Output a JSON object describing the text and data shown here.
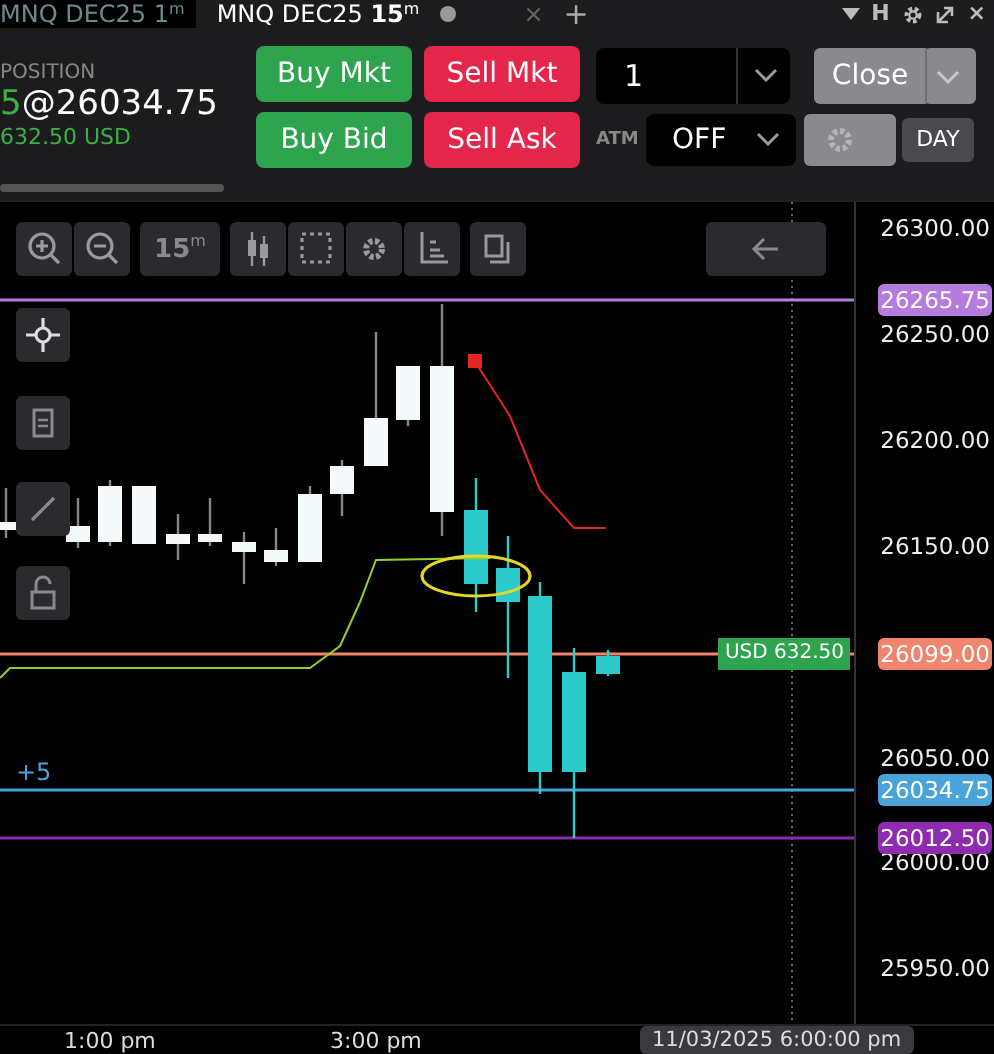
{
  "tabs": [
    {
      "label": "MNQ DEC25 1$^{m}$",
      "selected": false
    },
    {
      "label": "MNQ DEC25 **15**$^{m}$",
      "selected": true
    }
  ],
  "tab_bar": {
    "add": "+",
    "h_label": "H",
    "close": "×"
  },
  "order_panel": {
    "position_label": "POSITION",
    "position_qty": "5",
    "position_price": "@26034.75",
    "pnl": "632.50 USD",
    "buttons": [
      {
        "label": "Buy Mkt",
        "kind": "buy"
      },
      {
        "label": "Sell Mkt",
        "kind": "sell"
      },
      {
        "label": "Buy Bid",
        "kind": "buy"
      },
      {
        "label": "Sell Ask",
        "kind": "sell"
      }
    ],
    "quantity": "1",
    "close_button": "Close",
    "atm_label": "ATM",
    "atm_value": "OFF",
    "time_in_force": "DAY"
  },
  "chart": {
    "interval": "15$^{m}$",
    "price_ticks": [
      "26300.00",
      "26250.00",
      "26200.00",
      "26150.00",
      "26050.00",
      "26000.00",
      "25950.00"
    ],
    "price_lines": [
      {
        "label": "26265.75",
        "color": "#b57ce0"
      },
      {
        "label": "26099.00",
        "color": "#f0846c"
      },
      {
        "label": "26034.75",
        "color": "#4aa3db"
      },
      {
        "label": "26012.50",
        "color": "#8e2bb0"
      }
    ],
    "position_marker": "+5",
    "pnl_label": "USD 632.50",
    "time_labels": [
      "1:00 pm",
      "3:00 pm"
    ],
    "crosshair_time": "11/03/2025 6:00:00 pm"
  }
}
